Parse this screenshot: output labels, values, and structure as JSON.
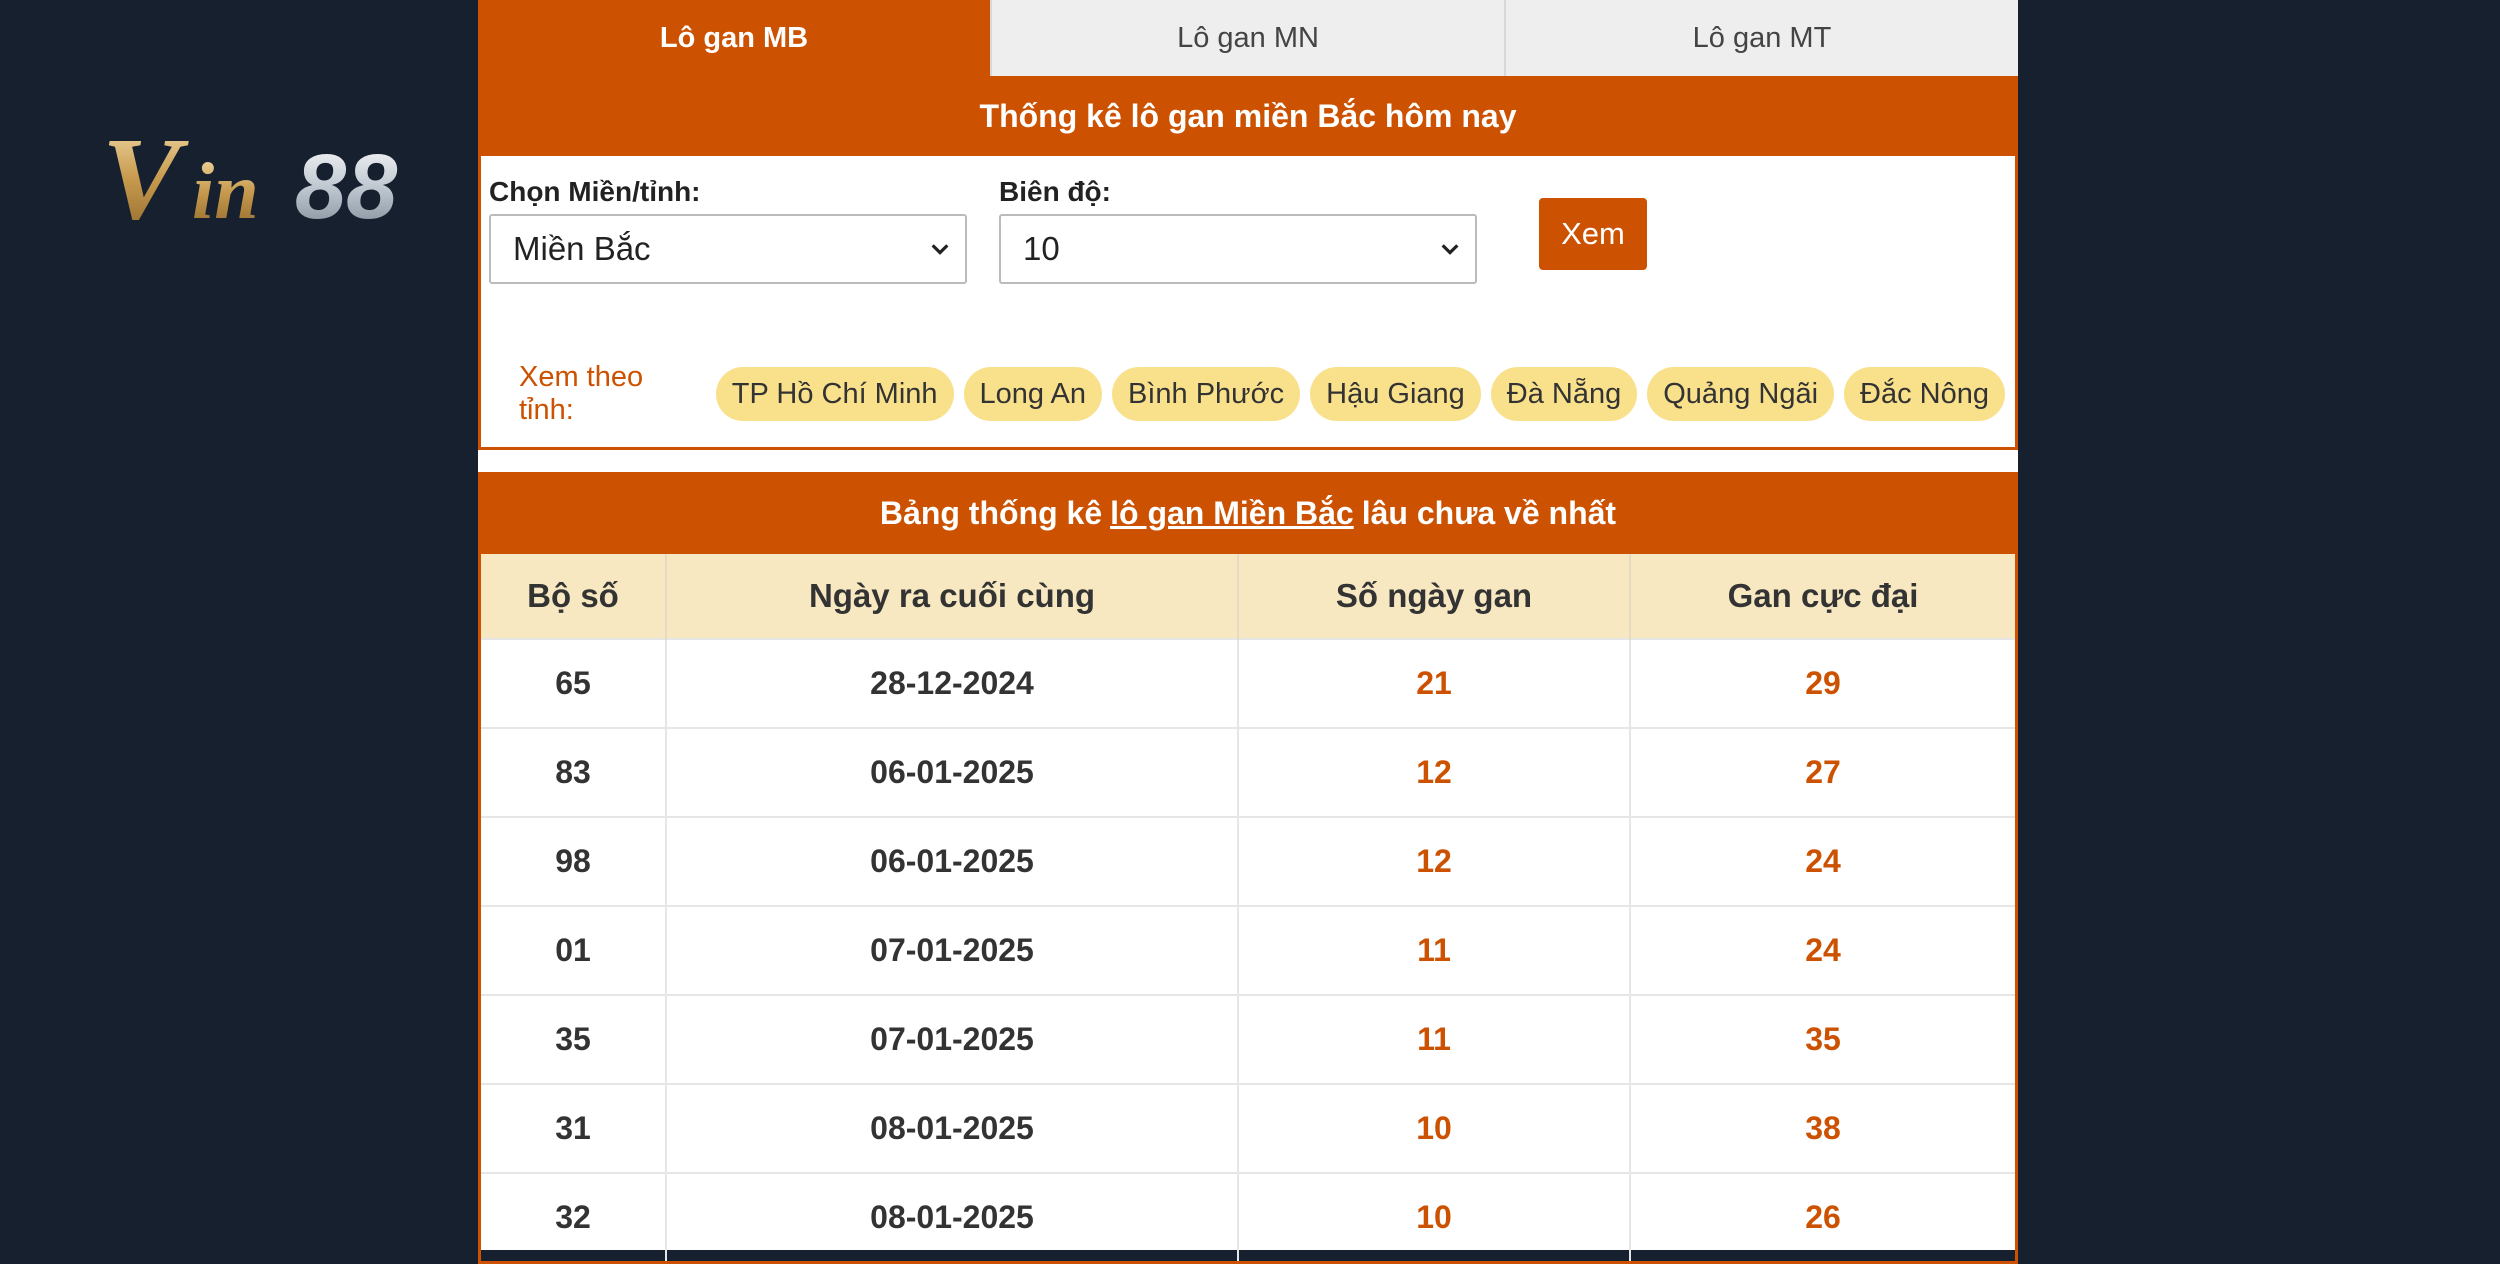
{
  "logo": {
    "text": "Vin88"
  },
  "tabs": [
    {
      "label": "Lô gan MB",
      "active": true
    },
    {
      "label": "Lô gan MN",
      "active": false
    },
    {
      "label": "Lô gan MT",
      "active": false
    }
  ],
  "stats_section": {
    "title": "Thống kê lô gan miền Bắc hôm nay",
    "region_label": "Chọn Miền/tỉnh:",
    "region_value": "Miền Bắc",
    "amplitude_label": "Biên độ:",
    "amplitude_value": "10",
    "view_button": "Xem",
    "province_label": "Xem theo tỉnh:",
    "provinces": [
      "TP Hồ Chí Minh",
      "Long An",
      "Bình Phước",
      "Hậu Giang",
      "Đà Nẵng",
      "Quảng Ngãi",
      "Đắc Nông"
    ]
  },
  "table": {
    "title_prefix": "Bảng thống kê",
    "title_link": "lô gan Miền Bắc",
    "title_suffix": "lâu chưa về nhất",
    "columns": [
      "Bộ số",
      "Ngày ra cuối cùng",
      "Số ngày gan",
      "Gan cực đại"
    ],
    "rows": [
      [
        "65",
        "28-12-2024",
        "21",
        "29"
      ],
      [
        "83",
        "06-01-2025",
        "12",
        "27"
      ],
      [
        "98",
        "06-01-2025",
        "12",
        "24"
      ],
      [
        "01",
        "07-01-2025",
        "11",
        "24"
      ],
      [
        "35",
        "07-01-2025",
        "11",
        "35"
      ],
      [
        "31",
        "08-01-2025",
        "10",
        "38"
      ],
      [
        "32",
        "08-01-2025",
        "10",
        "26"
      ]
    ]
  },
  "colors": {
    "accent": "#cc5100",
    "background": "#17202e",
    "pill": "#f9e08a",
    "table_head": "#f7e8c1"
  }
}
